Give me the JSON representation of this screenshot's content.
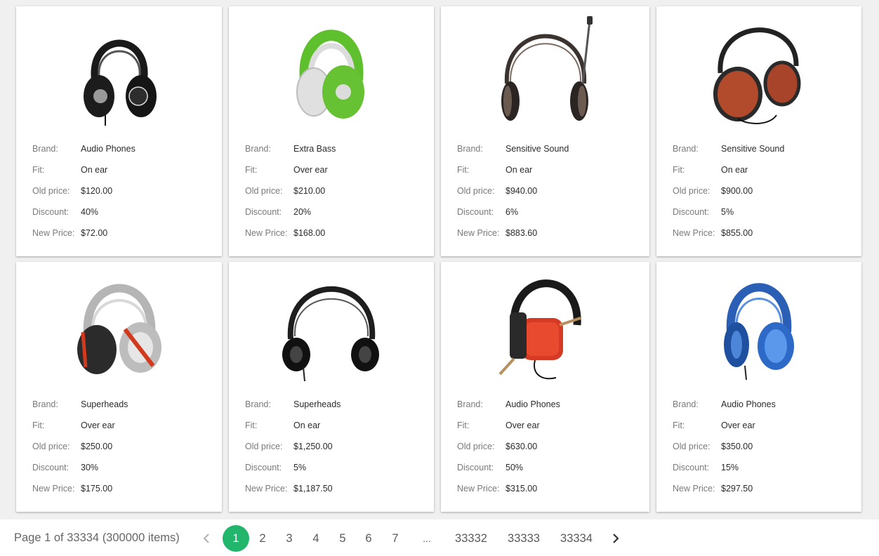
{
  "colors": {
    "accent": "#21b66b",
    "page_background": "#f0f0f0",
    "card_background": "#ffffff",
    "label_text": "#7a7a7a",
    "value_text": "#2b2b2b"
  },
  "field_labels": {
    "brand": "Brand:",
    "fit": "Fit:",
    "old_price": "Old price:",
    "discount": "Discount:",
    "new_price": "New Price:"
  },
  "products": [
    {
      "image": "black-headphones-image",
      "brand": "Audio Phones",
      "fit": "On ear",
      "old_price": "$120.00",
      "discount": "40%",
      "new_price": "$72.00"
    },
    {
      "image": "green-headphones-image",
      "brand": "Extra Bass",
      "fit": "Over ear",
      "old_price": "$210.00",
      "discount": "20%",
      "new_price": "$168.00"
    },
    {
      "image": "headset-with-microphone-image",
      "brand": "Sensitive Sound",
      "fit": "On ear",
      "old_price": "$940.00",
      "discount": "6%",
      "new_price": "$883.60"
    },
    {
      "image": "red-brown-headphones-image",
      "brand": "Sensitive Sound",
      "fit": "On ear",
      "old_price": "$900.00",
      "discount": "5%",
      "new_price": "$855.00"
    },
    {
      "image": "silver-red-headphones-image",
      "brand": "Superheads",
      "fit": "Over ear",
      "old_price": "$250.00",
      "discount": "30%",
      "new_price": "$175.00"
    },
    {
      "image": "black-minimal-headphones-image",
      "brand": "Superheads",
      "fit": "On ear",
      "old_price": "$1,250.00",
      "discount": "5%",
      "new_price": "$1,187.50"
    },
    {
      "image": "red-headphones-image",
      "brand": "Audio Phones",
      "fit": "Over ear",
      "old_price": "$630.00",
      "discount": "50%",
      "new_price": "$315.00"
    },
    {
      "image": "blue-headphones-image",
      "brand": "Audio Phones",
      "fit": "Over ear",
      "old_price": "$350.00",
      "discount": "15%",
      "new_price": "$297.50"
    }
  ],
  "pager": {
    "info": "Page 1 of 33334 (300000 items)",
    "prev_icon": "chevron-left-icon",
    "next_icon": "chevron-right-icon",
    "pages": [
      "1",
      "2",
      "3",
      "4",
      "5",
      "6",
      "7",
      "...",
      "33332",
      "33333",
      "33334"
    ],
    "current_page": "1"
  }
}
